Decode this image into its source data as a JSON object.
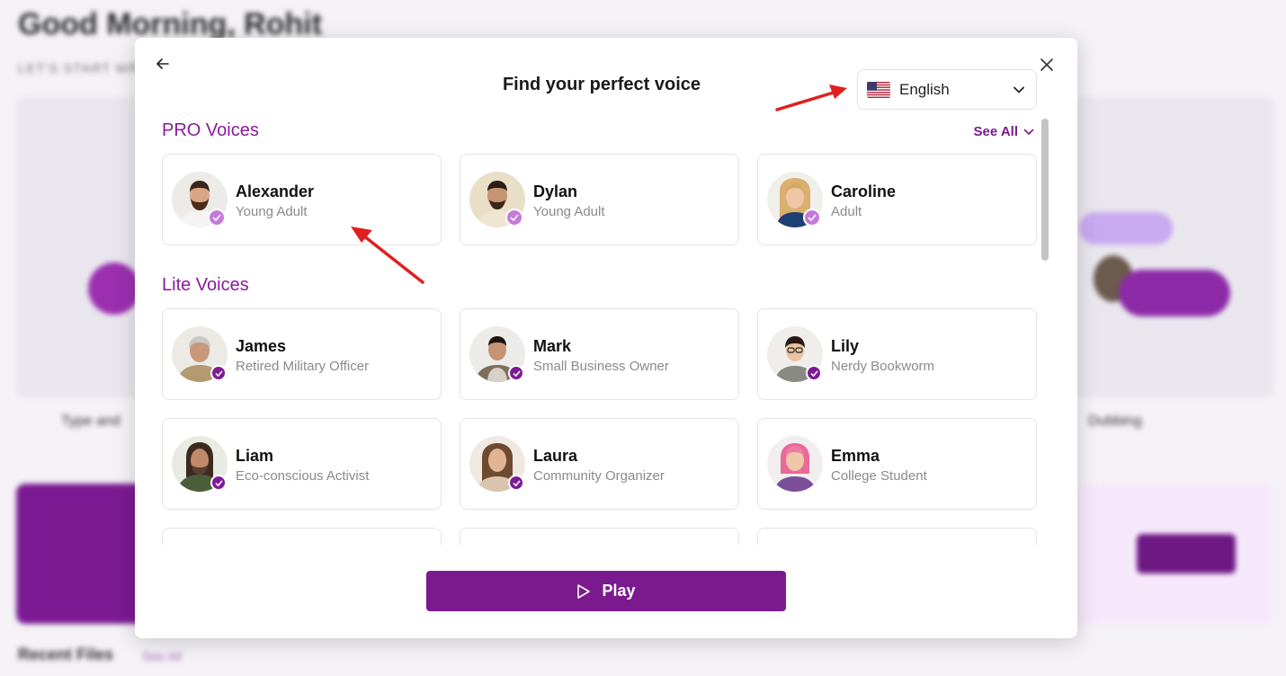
{
  "background": {
    "greeting": "Good Morning, Rohit",
    "subtitle": "LET'S START WRITING",
    "left_label": "Type and",
    "right_label": "Dubbing",
    "recent_files": "Recent Files",
    "see_all": "See All"
  },
  "modal": {
    "title": "Find your perfect voice",
    "language": {
      "selected": "English",
      "flag": "us-flag-icon"
    },
    "pro_section": {
      "title": "PRO Voices",
      "see_all": "See All",
      "voices": [
        {
          "name": "Alexander",
          "desc": "Young Adult"
        },
        {
          "name": "Dylan",
          "desc": "Young Adult"
        },
        {
          "name": "Caroline",
          "desc": "Adult"
        }
      ]
    },
    "lite_section": {
      "title": "Lite Voices",
      "voices": [
        {
          "name": "James",
          "desc": "Retired Military Officer"
        },
        {
          "name": "Mark",
          "desc": "Small Business Owner"
        },
        {
          "name": "Lily",
          "desc": "Nerdy Bookworm"
        },
        {
          "name": "Liam",
          "desc": "Eco-conscious Activist"
        },
        {
          "name": "Laura",
          "desc": "Community Organizer"
        },
        {
          "name": "Emma",
          "desc": "College Student"
        }
      ]
    },
    "play_label": "Play"
  },
  "colors": {
    "brand_purple": "#7b1a8e",
    "section_title": "#8a1a9c",
    "pro_badge": "#c47ad8",
    "lite_badge": "#7d1b95",
    "annotation_arrow": "#e02020"
  }
}
